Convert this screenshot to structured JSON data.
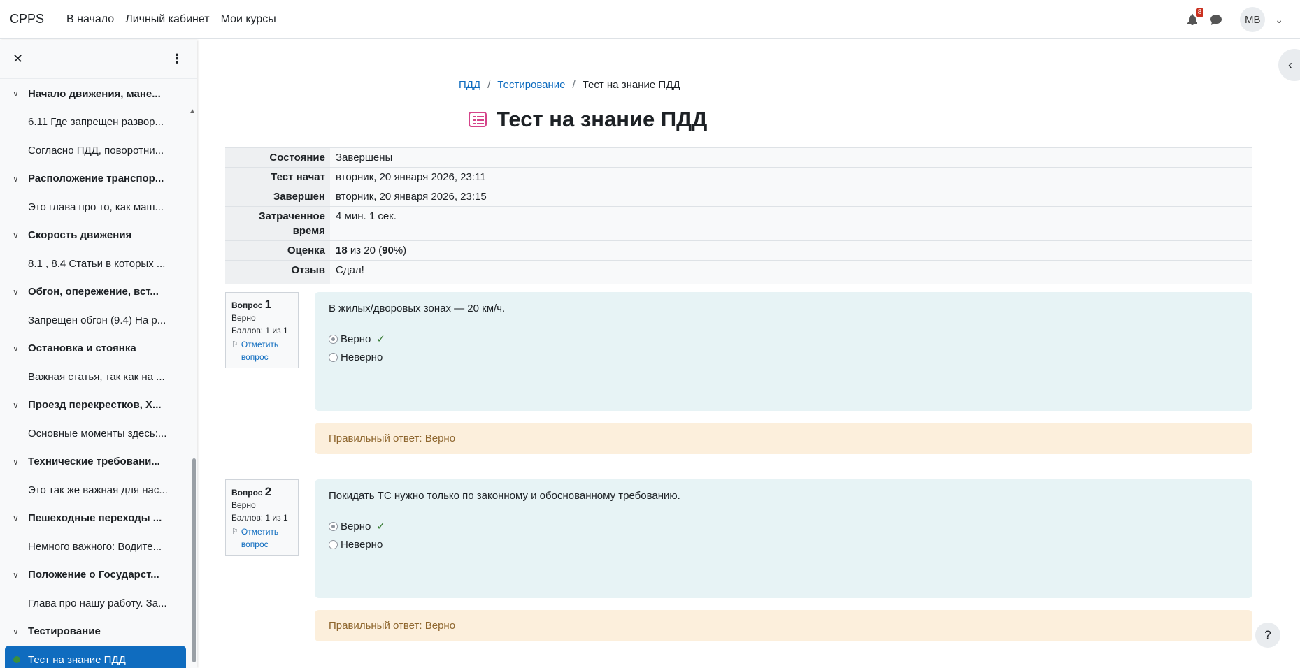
{
  "navbar": {
    "brand": "CPPS",
    "links": [
      "В начало",
      "Личный кабинет",
      "Мои курсы"
    ],
    "notification_count": "8",
    "avatar_initials": "MB"
  },
  "drawer": {
    "close_icon": "close-icon",
    "menu_icon": "kebab-icon",
    "items": [
      {
        "type": "section",
        "label": "Начало движения, мане..."
      },
      {
        "type": "activity",
        "label": "6.11 Где запрещен развор..."
      },
      {
        "type": "activity",
        "label": "Согласно ПДД, поворотни..."
      },
      {
        "type": "section",
        "label": "Расположение транспор..."
      },
      {
        "type": "activity",
        "label": "Это глава про то, как маш..."
      },
      {
        "type": "section",
        "label": "Скорость движения"
      },
      {
        "type": "activity",
        "label": "8.1 , 8.4 Статьи в которых ..."
      },
      {
        "type": "section",
        "label": "Обгон, опережение, вст..."
      },
      {
        "type": "activity",
        "label": "Запрещен обгон (9.4) На р..."
      },
      {
        "type": "section",
        "label": "Остановка и стоянка"
      },
      {
        "type": "activity",
        "label": "Важная статья, так как на ..."
      },
      {
        "type": "section",
        "label": "Проезд перекрестков, Х..."
      },
      {
        "type": "activity",
        "label": "Основные моменты здесь:..."
      },
      {
        "type": "section",
        "label": "Технические требовани..."
      },
      {
        "type": "activity",
        "label": "Это так же важная для нас..."
      },
      {
        "type": "section",
        "label": "Пешеходные переходы ..."
      },
      {
        "type": "activity",
        "label": "Немного важного: Водите..."
      },
      {
        "type": "section",
        "label": "Положение о Государст..."
      },
      {
        "type": "activity",
        "label": "Глава про нашу работу. За..."
      },
      {
        "type": "section",
        "label": "Тестирование"
      },
      {
        "type": "activity",
        "label": "Тест на знание ПДД",
        "active": true
      }
    ]
  },
  "breadcrumb": {
    "items": [
      "ПДД",
      "Тестирование"
    ],
    "current": "Тест на знание ПДД"
  },
  "page": {
    "title": "Тест на знание ПДД"
  },
  "summary": [
    {
      "label": "Состояние",
      "value": "Завершены"
    },
    {
      "label": "Тест начат",
      "value": "вторник, 20 января 2026, 23:11"
    },
    {
      "label": "Завершен",
      "value": "вторник, 20 января 2026, 23:15"
    },
    {
      "label": "Затраченное время",
      "value": "4 мин. 1 сек."
    },
    {
      "label": "Оценка",
      "grade_score": "18",
      "grade_of": "из 20",
      "grade_percent": "90"
    },
    {
      "label": "Отзыв",
      "value": "Сдал!"
    }
  ],
  "questions": [
    {
      "prefix": "Вопрос",
      "number": "1",
      "status": "Верно",
      "marks": "Баллов: 1 из 1",
      "flag": "Отметить вопрос",
      "text": "В жилых/дворовых зонах — 20 км/ч.",
      "answers": [
        {
          "label": "Верно",
          "checked": true
        },
        {
          "label": "Неверно",
          "checked": false
        }
      ],
      "feedback": "Правильный ответ: Верно"
    },
    {
      "prefix": "Вопрос",
      "number": "2",
      "status": "Верно",
      "marks": "Баллов: 1 из 1",
      "flag": "Отметить вопрос",
      "text": "Покидать ТС нужно только по законному и обоснованному требованию.",
      "answers": [
        {
          "label": "Верно",
          "checked": true
        },
        {
          "label": "Неверно",
          "checked": false
        }
      ],
      "feedback": "Правильный ответ: Верно"
    }
  ],
  "help_label": "?"
}
